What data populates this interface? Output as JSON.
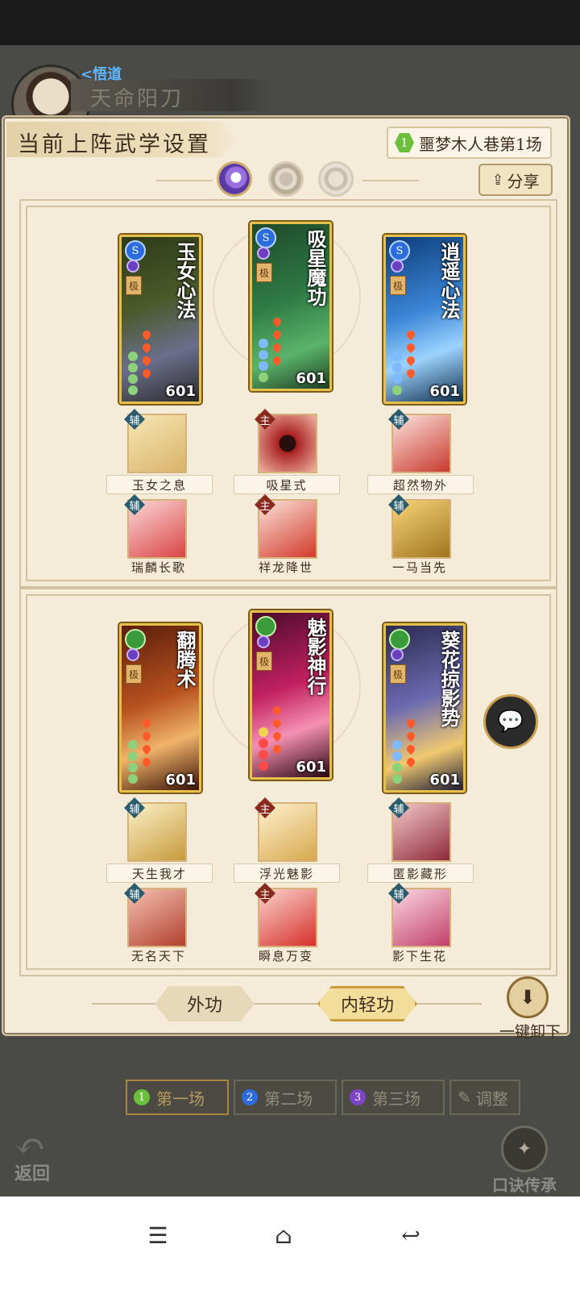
{
  "hud": {
    "tag": "<悟道",
    "player_name": "天命阳刀"
  },
  "panel": {
    "title": "当前上阵武学设置",
    "stage_number": "1",
    "stage_name": "噩梦木人巷第1场",
    "share_icon": "share-icon",
    "share_label": "分享",
    "type_icons": [
      "moon-orb-icon",
      "ring-orb-icon",
      "crescent-orb-icon"
    ]
  },
  "loadouts": [
    {
      "cards": [
        {
          "title": "玉女心法",
          "badge": "S",
          "tier": "极",
          "level": "601"
        },
        {
          "title": "吸星魔功",
          "badge": "S",
          "tier": "极",
          "level": "601"
        },
        {
          "title": "逍遥心法",
          "badge": "S",
          "tier": "极",
          "level": "601"
        }
      ],
      "skills_row1": [
        {
          "role": "辅",
          "name": "玉女之息"
        },
        {
          "role": "主",
          "name": "吸星式"
        },
        {
          "role": "辅",
          "name": "超然物外"
        }
      ],
      "skills_row2": [
        {
          "role": "辅",
          "name": "瑞麟长歌"
        },
        {
          "role": "主",
          "name": "祥龙降世"
        },
        {
          "role": "辅",
          "name": "一马当先"
        }
      ]
    },
    {
      "cards": [
        {
          "title": "翻腾术",
          "badge": "",
          "tier": "极",
          "level": "601"
        },
        {
          "title": "魅影神行",
          "badge": "",
          "tier": "极",
          "level": "601"
        },
        {
          "title": "葵花掠影势",
          "badge": "",
          "tier": "极",
          "level": "601"
        }
      ],
      "skills_row1": [
        {
          "role": "辅",
          "name": "天生我才"
        },
        {
          "role": "主",
          "name": "浮光魅影"
        },
        {
          "role": "辅",
          "name": "匿影藏形"
        }
      ],
      "skills_row2": [
        {
          "role": "辅",
          "name": "无名天下"
        },
        {
          "role": "主",
          "name": "瞬息万变"
        },
        {
          "role": "辅",
          "name": "影下生花"
        }
      ]
    }
  ],
  "modes": {
    "outer": "外功",
    "inner": "内轻功"
  },
  "unload": {
    "icon": "download-icon",
    "label": "一键卸下"
  },
  "chat": {
    "icon": "chat-bubble-icon"
  },
  "rounds": [
    {
      "num": "1",
      "label": "第一场",
      "color": "#6bbf3d"
    },
    {
      "num": "2",
      "label": "第二场",
      "color": "#2b6dde"
    },
    {
      "num": "3",
      "label": "第三场",
      "color": "#7b44c9"
    }
  ],
  "adjust_label": "调整",
  "back_label": "返回",
  "inherit_label": "口诀传承",
  "nav": {
    "menu_icon": "menu-icon",
    "home_icon": "home-icon",
    "back_icon": "back-icon"
  },
  "colors": {
    "panel_bg": "#f4ebd9",
    "card_border": "#e5c04b",
    "accent_green": "#6bbf3d"
  }
}
